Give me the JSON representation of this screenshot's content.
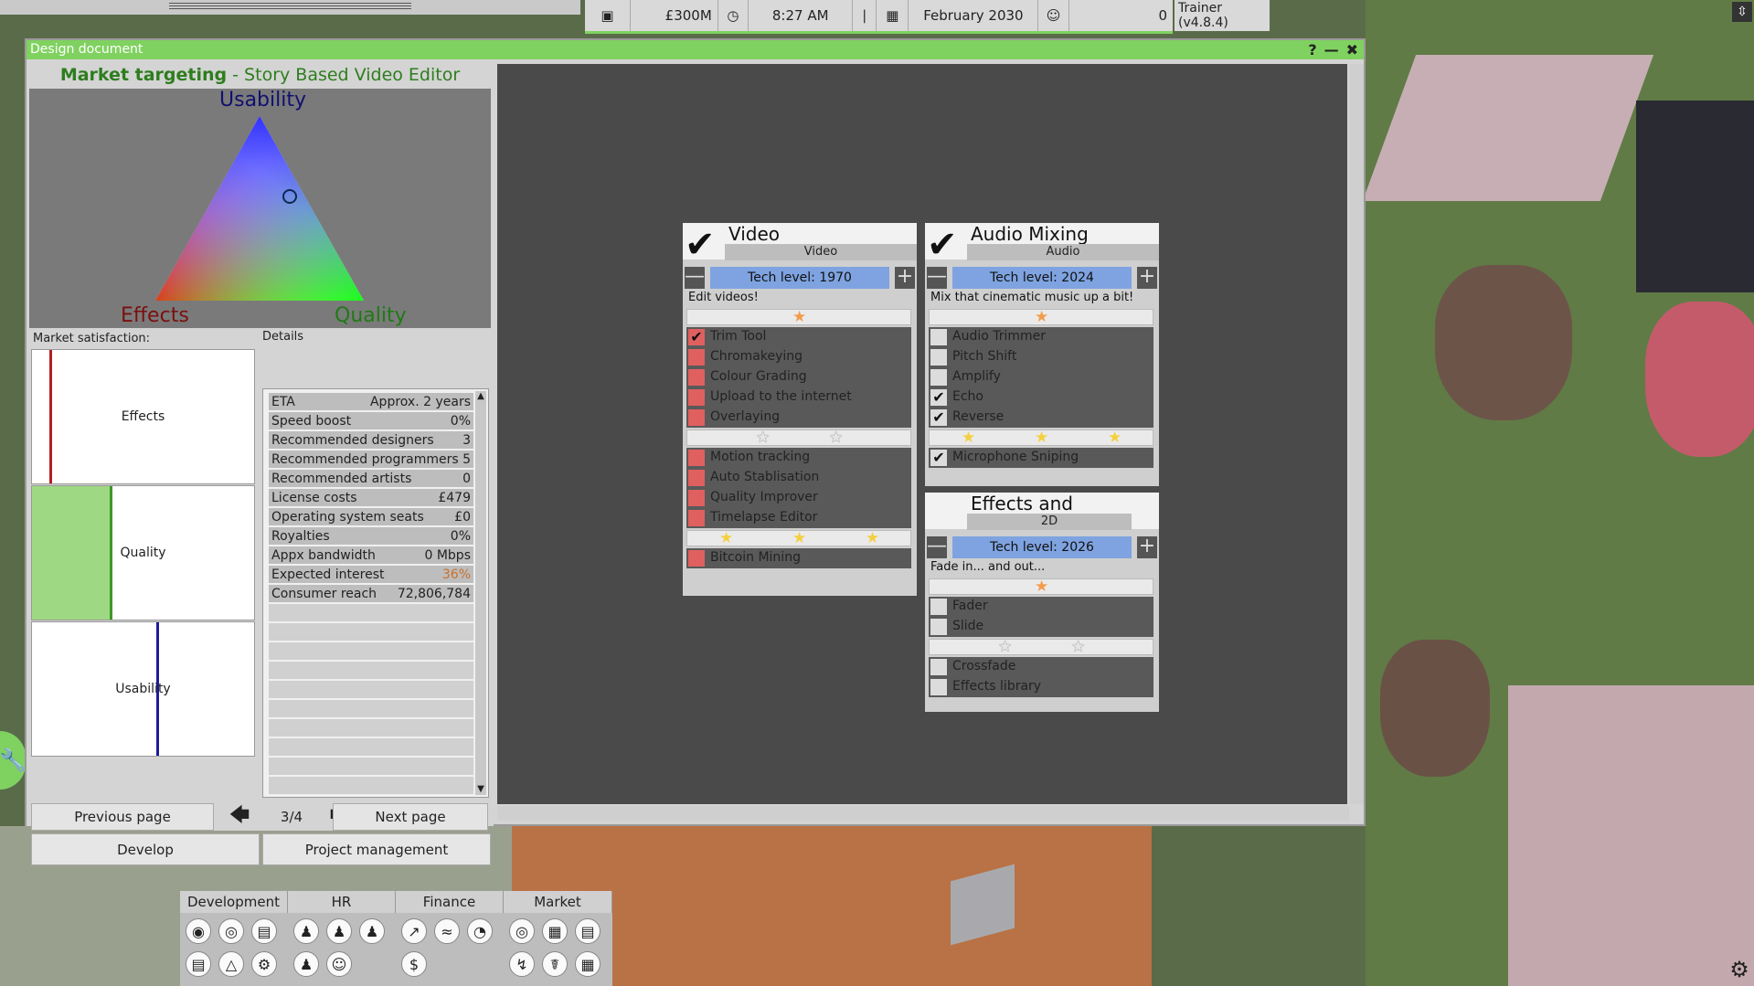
{
  "hud": {
    "money": "£300M",
    "time": "8:27 AM",
    "date": "February 2030",
    "counter": "0",
    "trainer": "Trainer (v4.8.4)"
  },
  "window": {
    "title": "Design document",
    "buttons": [
      "?",
      "—",
      "✖"
    ]
  },
  "market_targeting": {
    "heading": "Market targeting",
    "product": " - Story Based Video Editor",
    "labels": {
      "top": "Usability",
      "left": "Effects",
      "right": "Quality"
    },
    "satisfaction_label": "Market satisfaction:",
    "details_label": "Details",
    "satisfaction": [
      {
        "name": "Effects",
        "fill": 0.0,
        "target": 0.08,
        "color": "#b12020"
      },
      {
        "name": "Quality",
        "fill": 0.35,
        "target": 0.35,
        "color": "#3a9a28"
      },
      {
        "name": "Usability",
        "fill": 0.0,
        "target": 0.56,
        "color": "#1c1c9c"
      }
    ]
  },
  "details": [
    {
      "k": "ETA",
      "v": "Approx. 2 years",
      "accent": false
    },
    {
      "k": "Speed boost",
      "v": "0%",
      "accent": false
    },
    {
      "k": "Recommended designers",
      "v": "3",
      "accent": false
    },
    {
      "k": "Recommended programmers",
      "v": "5",
      "accent": false
    },
    {
      "k": "Recommended artists",
      "v": "0",
      "accent": false
    },
    {
      "k": "License costs",
      "v": "£479",
      "accent": false
    },
    {
      "k": "Operating system seats",
      "v": "£0",
      "accent": false
    },
    {
      "k": "Royalties",
      "v": "0%",
      "accent": false
    },
    {
      "k": "Appx bandwidth",
      "v": "0 Mbps",
      "accent": false
    },
    {
      "k": "Expected interest",
      "v": "36%",
      "accent": true
    },
    {
      "k": "Consumer reach",
      "v": "72,806,784",
      "accent": false
    }
  ],
  "pager": {
    "prev": "Previous page",
    "page": "3/4",
    "next": "Next page",
    "develop": "Develop",
    "project_management": "Project management"
  },
  "cards": {
    "video": {
      "title": "Video",
      "subtitle": "Video",
      "tech": "Tech level: 1970",
      "desc": "Edit videos!",
      "tiers": [
        {
          "stars": 1,
          "features": [
            {
              "name": "Trim Tool",
              "checked": true
            },
            {
              "name": "Chromakeying",
              "checked": false
            },
            {
              "name": "Colour Grading",
              "checked": false
            },
            {
              "name": "Upload to the internet",
              "checked": false
            },
            {
              "name": "Overlaying",
              "checked": false
            }
          ]
        },
        {
          "stars": 2,
          "features": [
            {
              "name": "Motion tracking",
              "checked": false
            },
            {
              "name": "Auto Stablisation",
              "checked": false
            },
            {
              "name": "Quality Improver",
              "checked": false
            },
            {
              "name": "Timelapse Editor",
              "checked": false
            }
          ]
        },
        {
          "stars": 3,
          "features": [
            {
              "name": "Bitcoin Mining",
              "checked": false
            }
          ]
        }
      ]
    },
    "audio": {
      "title": "Audio Mixing",
      "subtitle": "Audio",
      "tech": "Tech level: 2024",
      "desc": "Mix that cinematic music up a bit!",
      "tiers": [
        {
          "stars": 1,
          "features": [
            {
              "name": "Audio Trimmer",
              "checked": false
            },
            {
              "name": "Pitch Shift",
              "checked": false
            },
            {
              "name": "Amplify",
              "checked": false
            },
            {
              "name": "Echo",
              "checked": true
            },
            {
              "name": "Reverse",
              "checked": true
            }
          ]
        },
        {
          "stars": 3,
          "features": [
            {
              "name": "Microphone Sniping",
              "checked": true
            }
          ]
        }
      ]
    },
    "effects": {
      "title": "Effects and",
      "subtitle": "2D",
      "tech": "Tech level: 2026",
      "desc": "Fade in... and out...",
      "tiers": [
        {
          "stars": 1,
          "features": [
            {
              "name": "Fader",
              "checked": false
            },
            {
              "name": "Slide",
              "checked": false
            }
          ]
        },
        {
          "stars": 2,
          "features": [
            {
              "name": "Crossfade",
              "checked": false
            },
            {
              "name": "Effects library",
              "checked": false
            }
          ]
        }
      ]
    }
  },
  "toolbar": {
    "tabs": [
      "Development",
      "HR",
      "Finance",
      "Market"
    ]
  }
}
